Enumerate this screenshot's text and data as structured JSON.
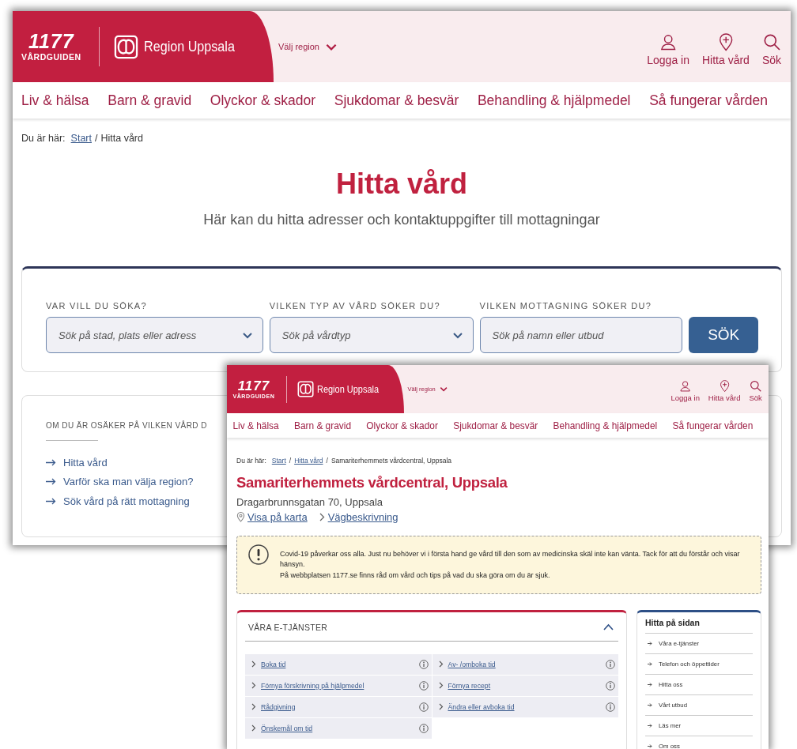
{
  "back_window": {
    "header": {
      "logo_number": "1177",
      "logo_word": "VÅRDGUIDEN",
      "region_name": "Region Uppsala",
      "region_picker": "Välj region",
      "actions": [
        {
          "label": "Logga in",
          "kind": "user"
        },
        {
          "label": "Hitta vård",
          "kind": "pin"
        },
        {
          "label": "Sök",
          "kind": "search"
        }
      ]
    },
    "nav": [
      "Liv & hälsa",
      "Barn & gravid",
      "Olyckor & skador",
      "Sjukdomar & besvär",
      "Behandling & hjälpmedel",
      "Så fungerar vården"
    ],
    "breadcrumb": {
      "label": "Du är här:",
      "separator": "/",
      "items": [
        {
          "text": "Start",
          "link": true
        },
        {
          "text": "Hitta vård",
          "link": false
        }
      ]
    },
    "title": "Hitta vård",
    "subtitle": "Här kan du hitta adresser och kontaktuppgifter till mottagningar",
    "search_form": {
      "fields": [
        {
          "label": "VAR VILL DU SÖKA?",
          "placeholder": "Sök på stad, plats eller adress",
          "kind": "dropdown"
        },
        {
          "label": "VILKEN TYP AV VÅRD SÖKER DU?",
          "placeholder": "Sök på vårdtyp",
          "kind": "dropdown"
        },
        {
          "label": "VILKEN MOTTAGNING SÖKER DU?",
          "placeholder": "Sök på namn eller utbud",
          "kind": "text"
        }
      ],
      "button": "SÖK"
    },
    "help_card": {
      "heading": "OM DU ÄR OSÄKER PÅ VILKEN VÅRD D",
      "links": [
        "Hitta vård",
        "Varför ska man välja region?",
        "Sök vård på rätt mottagning"
      ]
    }
  },
  "front_window": {
    "header": {
      "logo_number": "1177",
      "logo_word": "VÅRDGUIDEN",
      "region_name": "Region Uppsala",
      "region_picker": "Välj region",
      "actions": [
        {
          "label": "Logga in",
          "kind": "user"
        },
        {
          "label": "Hitta vård",
          "kind": "pin"
        },
        {
          "label": "Sök",
          "kind": "search"
        }
      ]
    },
    "nav": [
      "Liv & hälsa",
      "Barn & gravid",
      "Olyckor & skador",
      "Sjukdomar & besvär",
      "Behandling & hjälpmedel",
      "Så fungerar vården"
    ],
    "breadcrumb": {
      "label": "Du är här:",
      "separator": "/",
      "items": [
        {
          "text": "Start",
          "link": true
        },
        {
          "text": "Hitta vård",
          "link": true
        },
        {
          "text": "Samariterhemmets vårdcentral, Uppsala",
          "link": false
        }
      ]
    },
    "title": "Samariterhemmets vårdcentral, Uppsala",
    "address": "Dragarbrunnsgatan 70, Uppsala",
    "location_links": [
      {
        "label": "Visa på karta",
        "kind": "map"
      },
      {
        "label": "Vägbeskrivning",
        "kind": "directions"
      }
    ],
    "alert": {
      "paragraphs": [
        "Covid-19 påverkar oss alla. Just nu behöver vi i första hand ge vård till den som av medicinska skäl inte kan vänta. Tack för att du förstår och visar hänsyn.",
        "På webbplatsen 1177.se finns råd om vård och tips på vad du ska göra om du är sjuk."
      ]
    },
    "e_services": {
      "heading": "VÅRA E-TJÄNSTER",
      "expanded": true,
      "items": [
        "Boka tid",
        "Av- /omboka tid",
        "Förnya förskrivning på hjälpmedel",
        "Förnya recept",
        "Rådgivning",
        "Ändra eller avboka tid",
        "Önskemål om tid"
      ]
    },
    "page_toc": {
      "heading": "Hitta på sidan",
      "items": [
        "Våra e-tjänster",
        "Telefon och öppettider",
        "Hitta oss",
        "Vårt utbud",
        "Läs mer",
        "Om oss"
      ]
    }
  }
}
